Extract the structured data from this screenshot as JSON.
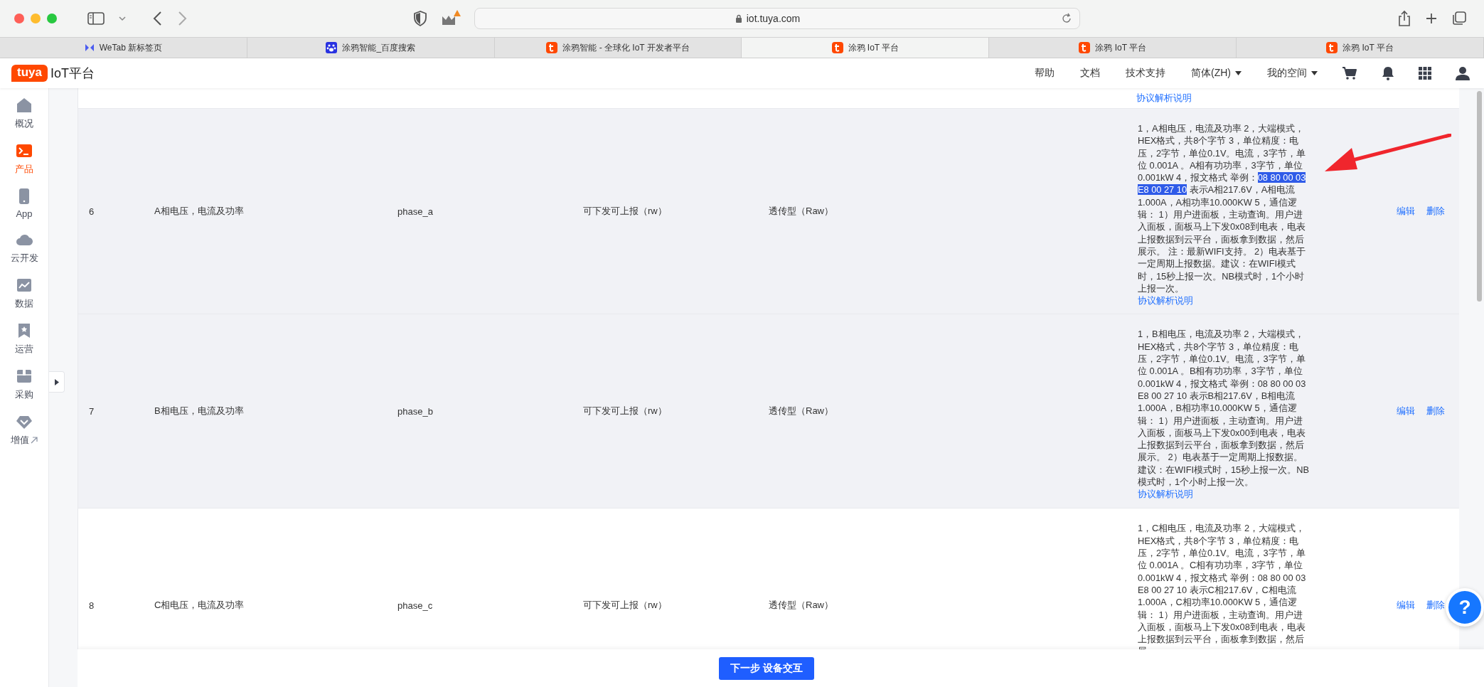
{
  "browser": {
    "address": "iot.tuya.com",
    "tabs": [
      {
        "title": "WeTab 新标签页",
        "kind": "wetab",
        "selected": false
      },
      {
        "title": "涂鸦智能_百度搜索",
        "kind": "baidu",
        "selected": false
      },
      {
        "title": "涂鸦智能 - 全球化 IoT 开发者平台",
        "kind": "tuya",
        "selected": false
      },
      {
        "title": "涂鸦 IoT 平台",
        "kind": "tuya",
        "selected": true
      },
      {
        "title": "涂鸦 IoT 平台",
        "kind": "tuya",
        "selected": false
      },
      {
        "title": "涂鸦 IoT 平台",
        "kind": "tuya",
        "selected": false
      }
    ]
  },
  "header": {
    "logo": "tuya",
    "title": "IoT平台",
    "nav": [
      {
        "label": "帮助",
        "dropdown": false
      },
      {
        "label": "文档",
        "dropdown": false
      },
      {
        "label": "技术支持",
        "dropdown": false
      },
      {
        "label": "简体(ZH)",
        "dropdown": true
      },
      {
        "label": "我的空间",
        "dropdown": true
      }
    ]
  },
  "sidebar": {
    "items": [
      {
        "label": "概况",
        "selected": false,
        "external": false
      },
      {
        "label": "产品",
        "selected": true,
        "external": false
      },
      {
        "label": "App",
        "selected": false,
        "external": false
      },
      {
        "label": "云开发",
        "selected": false,
        "external": false
      },
      {
        "label": "数据",
        "selected": false,
        "external": false
      },
      {
        "label": "运营",
        "selected": false,
        "external": false
      },
      {
        "label": "采购",
        "selected": false,
        "external": false
      },
      {
        "label": "增值",
        "selected": false,
        "external": true
      }
    ]
  },
  "table": {
    "rows": [
      {
        "kind": "partial",
        "link": "协议解析说明"
      },
      {
        "kind": "full",
        "shaded": true,
        "number": "6",
        "name": "A相电压，电流及功率",
        "identifier": "phase_a",
        "access": "可下发可上报（rw）",
        "data_type": "透传型（Raw）",
        "description": [
          {
            "text": "1，A相电压，电流及功率 2，大端模式，HEX格式，共8个字节 3，单位精度：电压，2字节，单位0.1V。电流，3字节，单位 0.001A 。A相有功功率，3字节，单位0.001kW 4，报文格式 举例：",
            "selected": false
          },
          {
            "text": "08 80 00 03 E8 00 27 10",
            "selected": true
          },
          {
            "text": " 表示A相217.6V，A相电流1.000A，A相功率10.000KW 5，通信逻辑： 1）用户进面板，主动查询。用户进入面板，面板马上下发0x08到电表，电表上报数据到云平台，面板拿到数据，然后展示。 注：最新WIFI支持。 2）电表基于一定周期上报数据。建议：在WIFI模式时，15秒上报一次。NB模式时，1个小时上报一次。",
            "selected": false
          }
        ],
        "link": "协议解析说明",
        "actions": [
          "编辑",
          "删除"
        ]
      },
      {
        "kind": "full",
        "shaded": true,
        "number": "7",
        "name": "B相电压，电流及功率",
        "identifier": "phase_b",
        "access": "可下发可上报（rw）",
        "data_type": "透传型（Raw）",
        "description": [
          {
            "text": "1，B相电压，电流及功率 2，大端模式，HEX格式，共8个字节 3，单位精度：电压，2字节，单位0.1V。电流，3字节，单位 0.001A 。B相有功功率，3字节，单位0.001kW 4，报文格式 举例：08 80 00 03 E8 00 27 10 表示B相217.6V，B相电流1.000A，B相功率10.000KW 5，通信逻辑： 1）用户进面板，主动查询。用户进入面板，面板马上下发0x00到电表，电表上报数据到云平台，面板拿到数据，然后展示。 2）电表基于一定周期上报数据。建议：在WIFI模式时，15秒上报一次。NB模式时，1个小时上报一次。",
            "selected": false
          }
        ],
        "link": "协议解析说明",
        "actions": [
          "编辑",
          "删除"
        ]
      },
      {
        "kind": "full",
        "shaded": false,
        "number": "8",
        "name": "C相电压，电流及功率",
        "identifier": "phase_c",
        "access": "可下发可上报（rw）",
        "data_type": "透传型（Raw）",
        "description": [
          {
            "text": "1，C相电压，电流及功率 2，大端模式，HEX格式，共8个字节 3，单位精度：电压，2字节，单位0.1V。电流，3字节，单位 0.001A 。C相有功功率，3字节，单位0.001kW 4，报文格式 举例：08 80 00 03 E8 00 27 10 表示C相217.6V，C相电流1.000A，C相功率10.000KW 5，通信逻辑： 1）用户进面板，主动查询。用户进入面板，面板马上下发0x08到电表，电表上报数据到云平台，面板拿到数据，然后展",
            "selected": false
          }
        ],
        "actions": [
          "编辑",
          "删除"
        ]
      }
    ]
  },
  "annotation_arrow": true,
  "footer": {
    "button": "下一步 设备交互"
  },
  "help_button": "?"
}
